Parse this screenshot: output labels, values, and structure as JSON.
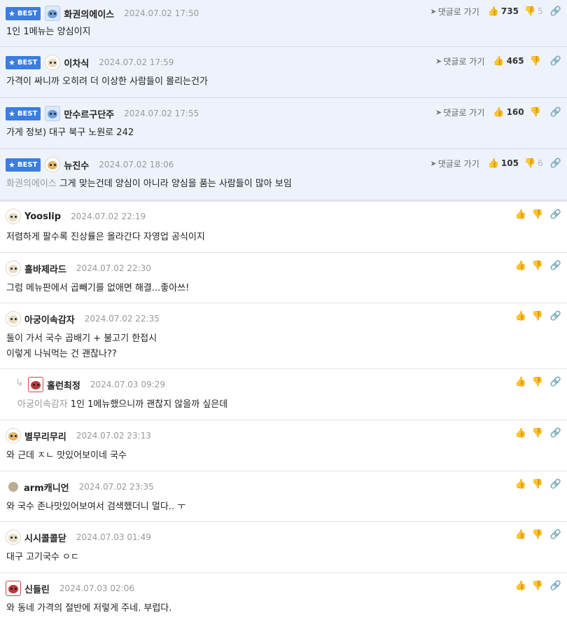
{
  "best_label": "BEST",
  "reply_label": "댓글로 가기",
  "comments": [
    {
      "best": true,
      "nick": "화권의에이스",
      "date": "2024.07.02 17:50",
      "up": "735",
      "down": "5",
      "body": "1인 1메뉴는 양심이지",
      "mention": ""
    },
    {
      "best": true,
      "nick": "이차식",
      "date": "2024.07.02 17:59",
      "up": "465",
      "down": "",
      "body": "가격이 싸니까 오히려 더 이상한 사람들이 몰리는건가",
      "mention": ""
    },
    {
      "best": true,
      "nick": "만수르구단주",
      "date": "2024.07.02 17:55",
      "up": "160",
      "down": "",
      "body": "가게 정보) 대구 북구 노원로 242",
      "mention": ""
    },
    {
      "best": true,
      "nick": "뉴진수",
      "date": "2024.07.02 18:06",
      "up": "105",
      "down": "6",
      "body": "그게 맞는건데 양심이 아니라 양심을 품는 사람들이 많아 보임",
      "mention": "화권의에이스"
    },
    {
      "nick": "Yooslip",
      "date": "2024.07.02 22:19",
      "body": "저렴하게 팔수록 진상률은 올라간다 자영업 공식이지"
    },
    {
      "nick": "흘바제라드",
      "date": "2024.07.02 22:30",
      "body": "그럼 메뉴판에서 곱빼기를 없애면 해결...좋아쓰!"
    },
    {
      "nick": "아궁이속감자",
      "date": "2024.07.02 22:35",
      "body": "둘이 가서 국수 곱배기 + 불고기 한접시",
      "body2": "이렇게 나눠먹는 건 괜찮나??"
    },
    {
      "reply": true,
      "nick": "홀런최정",
      "date": "2024.07.03 09:29",
      "body": "1인 1메뉴했으니까 괜찮지 않을까 싶은데",
      "mention": "아궁이속감자"
    },
    {
      "nick": "별무리무리",
      "date": "2024.07.02 23:13",
      "body": "와 근데 ㅈㄴ 맛있어보이네 국수"
    },
    {
      "nick": "arm캐니언",
      "date": "2024.07.02 23:35",
      "body": "와 국수 존나맛있어보여서 검색했더니 멀다.. ㅜ"
    },
    {
      "nick": "시시콜콜닫",
      "date": "2024.07.03 01:49",
      "body": "대구 고기국수 ㅇㄷ"
    },
    {
      "nick": "신들린",
      "date": "2024.07.03 02:06",
      "body": "와 동네 가격의 절반에 저렇게 주네. 부럽다."
    }
  ]
}
